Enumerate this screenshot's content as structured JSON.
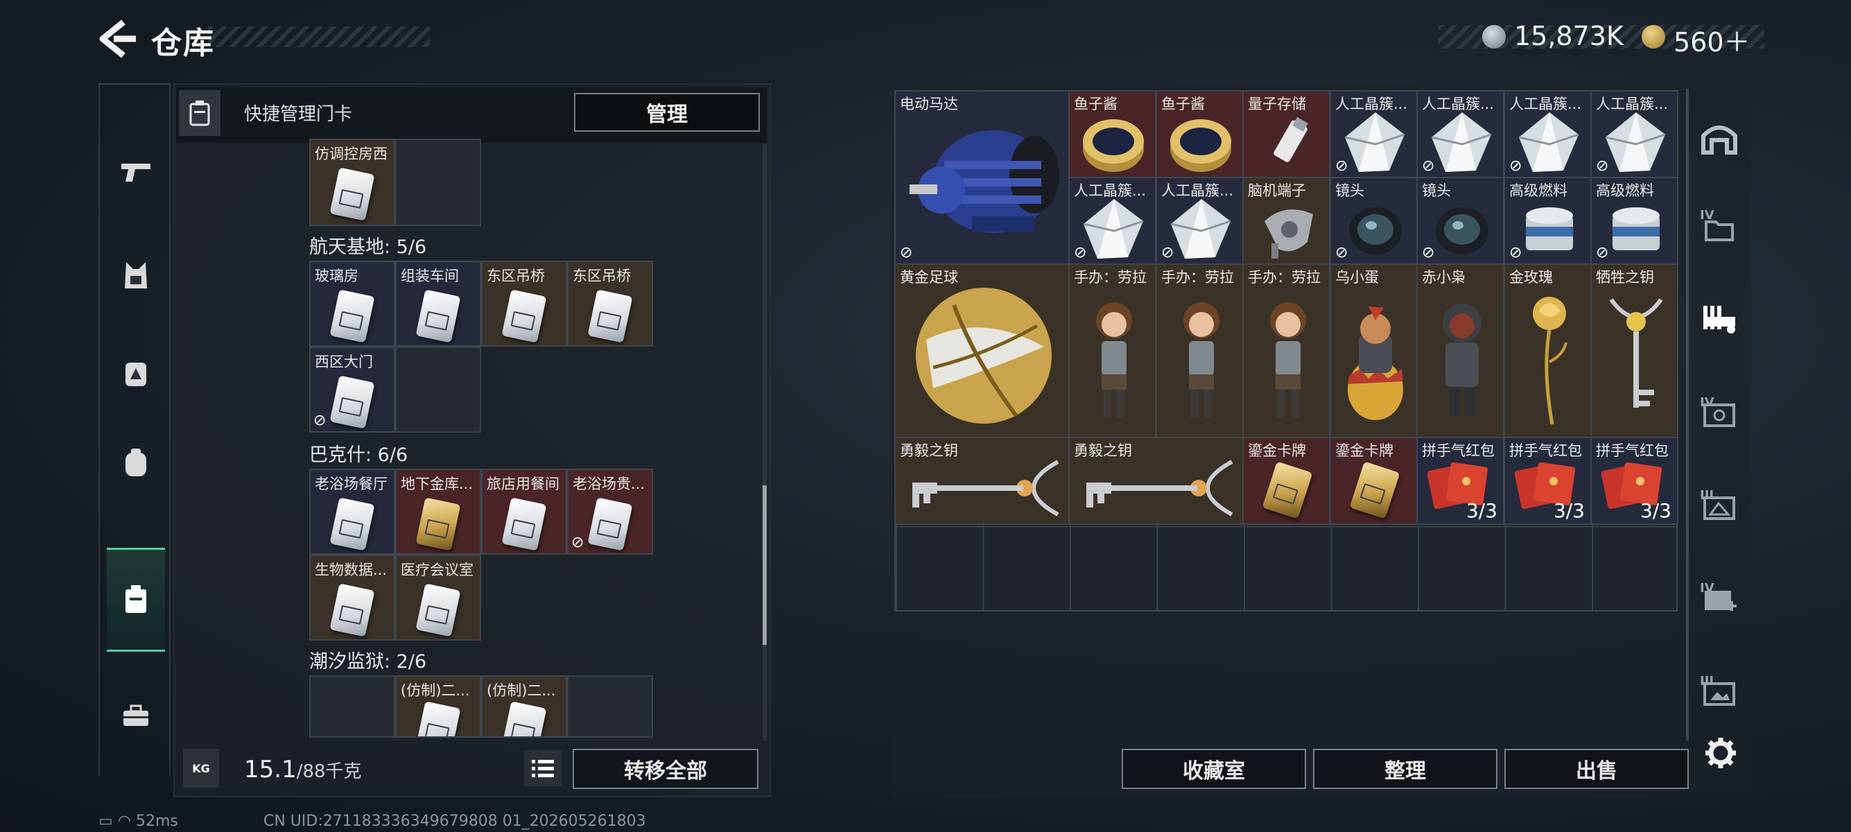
{
  "header": {
    "title": "仓库",
    "back_icon": "chevron-left-icon"
  },
  "currency": [
    {
      "icon": "silver-coin-icon",
      "amount": "15,873K"
    },
    {
      "icon": "gold-coin-icon",
      "amount": "560＋"
    }
  ],
  "left_rail": {
    "tabs": [
      {
        "icon": "gun-icon",
        "glyph": "╤"
      },
      {
        "icon": "vest-icon",
        "glyph": "⊠"
      },
      {
        "icon": "backpack-warning-icon",
        "glyph": "▲"
      },
      {
        "icon": "backpack-icon",
        "glyph": "◉"
      },
      {
        "icon": "keycard-case-icon",
        "glyph": "▣",
        "active": true
      },
      {
        "icon": "toolbox-icon",
        "glyph": "▬"
      }
    ]
  },
  "keycard_panel": {
    "title": "快捷管理门卡",
    "manage_label": "管理",
    "top_card": {
      "label": "仿调控房西"
    },
    "sections": [
      {
        "title": "航天基地: 5/6",
        "cards": [
          "玻璃房",
          "组装车间",
          "东区吊桥",
          "东区吊桥",
          "西区大门"
        ]
      },
      {
        "title": "巴克什: 6/6",
        "cards": [
          "老浴场餐厅",
          "地下金库...",
          "旅店用餐间",
          "老浴场贵...",
          "生物数据...",
          "医疗会议室"
        ]
      },
      {
        "title": "潮汐监狱: 2/6",
        "cards": [
          "(仿制)二...",
          "(仿制)二..."
        ]
      }
    ],
    "footer": {
      "weight_icon_label": "KG",
      "weight_current": "15.1",
      "weight_max": "/88千克",
      "list_icon": "list-icon",
      "transfer_label": "转移全部"
    }
  },
  "stash_grid": {
    "items": [
      {
        "label": "电动马达",
        "lock": true
      },
      {
        "label": "鱼子酱"
      },
      {
        "label": "鱼子酱"
      },
      {
        "label": "量子存储"
      },
      {
        "label": "人工晶簇...",
        "lock": true
      },
      {
        "label": "人工晶簇...",
        "lock": true
      },
      {
        "label": "人工晶簇...",
        "lock": true
      },
      {
        "label": "人工晶簇...",
        "lock": true
      },
      {
        "label": "人工晶簇...",
        "lock": true
      },
      {
        "label": "人工晶簇...",
        "lock": true
      },
      {
        "label": "脑机端子"
      },
      {
        "label": "镜头",
        "lock": true
      },
      {
        "label": "镜头",
        "lock": true
      },
      {
        "label": "高级燃料",
        "lock": true
      },
      {
        "label": "高级燃料",
        "lock": true
      },
      {
        "label": "黄金足球"
      },
      {
        "label": "手办：劳拉"
      },
      {
        "label": "手办：劳拉"
      },
      {
        "label": "手办：劳拉"
      },
      {
        "label": "乌小蛋"
      },
      {
        "label": "赤小枭"
      },
      {
        "label": "金玫瑰"
      },
      {
        "label": "牺牲之钥"
      },
      {
        "label": "勇毅之钥"
      },
      {
        "label": "勇毅之钥"
      },
      {
        "label": "鎏金卡牌"
      },
      {
        "label": "鎏金卡牌"
      },
      {
        "label": "拼手气红包",
        "count": "3/3"
      },
      {
        "label": "拼手气红包",
        "count": "3/3"
      },
      {
        "label": "拼手气红包",
        "count": "3/3"
      }
    ]
  },
  "actions": {
    "collection": "收藏室",
    "organize": "整理",
    "sell": "出售"
  },
  "right_rail": {
    "tabs": [
      {
        "icon": "vault-icon",
        "tier": ""
      },
      {
        "icon": "folder-icon",
        "tier": "IV"
      },
      {
        "icon": "gun-rack-icon",
        "tier": "",
        "active": true
      },
      {
        "icon": "safe-icon",
        "tier": "IV"
      },
      {
        "icon": "gallery-icon",
        "tier": "III"
      },
      {
        "icon": "medical-kit-icon",
        "tier": "IV"
      },
      {
        "icon": "display-case-icon",
        "tier": "III"
      }
    ],
    "settings_icon": "gear-icon"
  },
  "status_bar": {
    "battery_icon": "battery-icon",
    "wifi_icon": "wifi-icon",
    "ping": "52ms",
    "uid": "CN UID:271183336349679808 01_202605261803"
  }
}
